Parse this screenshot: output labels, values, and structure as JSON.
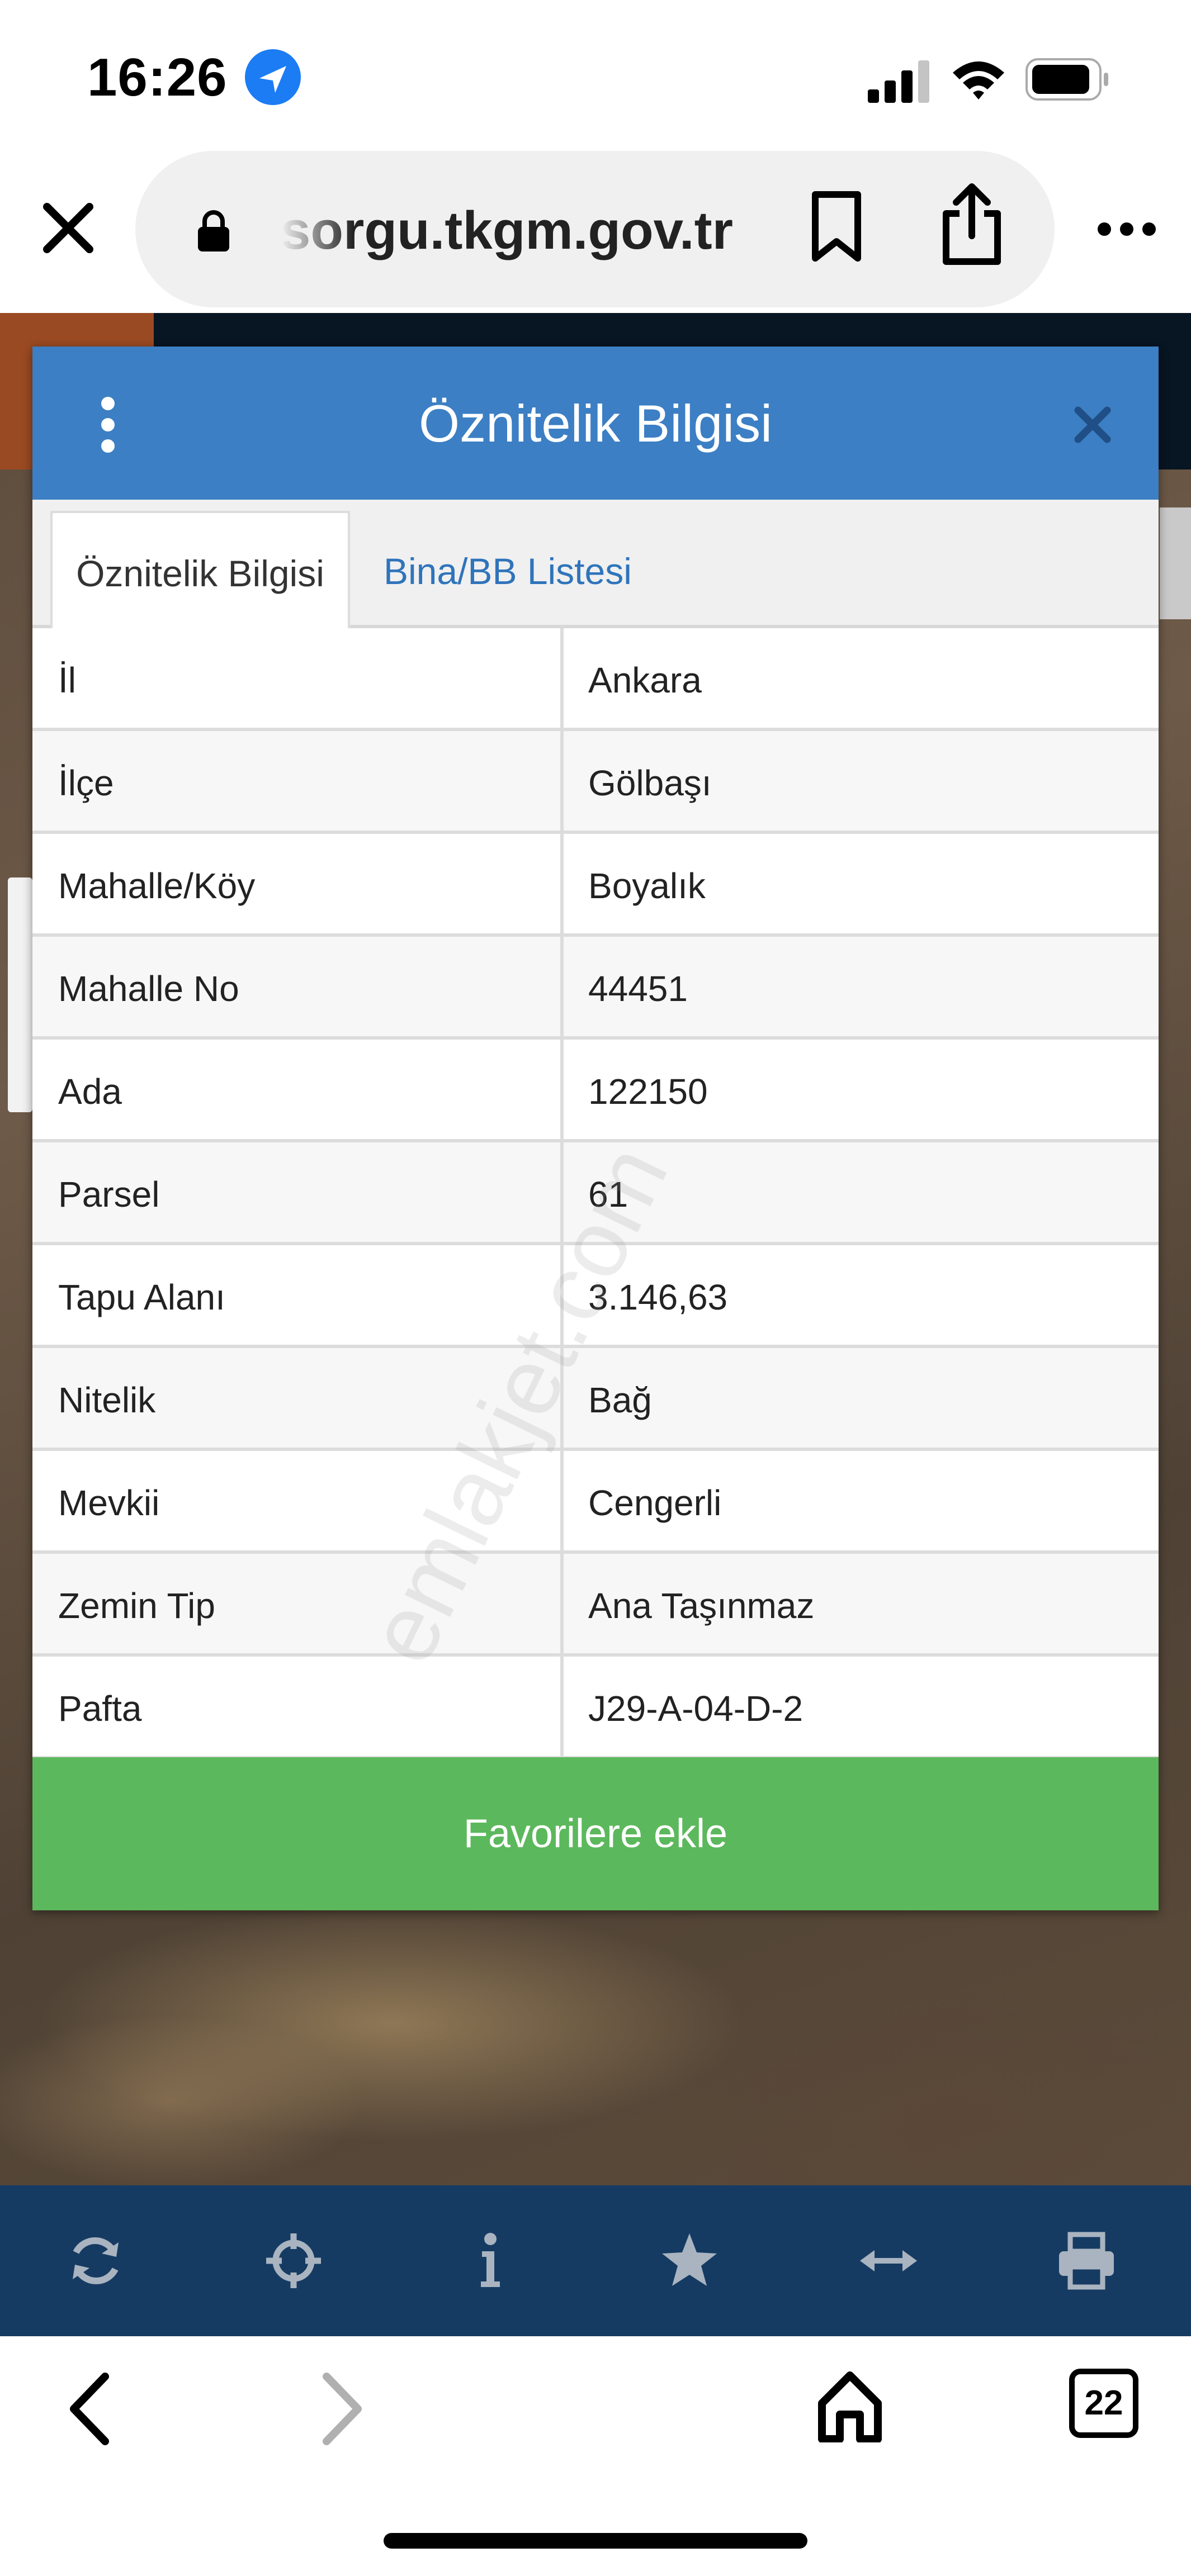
{
  "status_bar": {
    "time": "16:26",
    "icons": [
      "location-arrow-icon",
      "signal-icon",
      "wifi-icon",
      "battery-icon"
    ]
  },
  "browser": {
    "url": "sorgu.tkgm.gov.tr",
    "icons": [
      "close-icon",
      "lock-icon",
      "bookmark-icon",
      "share-icon",
      "more-icon"
    ]
  },
  "modal": {
    "title": "Öznitelik Bilgisi",
    "tabs": [
      {
        "label": "Öznitelik Bilgisi",
        "active": true
      },
      {
        "label": "Bina/BB Listesi",
        "active": false
      }
    ],
    "rows": [
      {
        "key": "İl",
        "value": "Ankara"
      },
      {
        "key": "İlçe",
        "value": "Gölbaşı"
      },
      {
        "key": "Mahalle/Köy",
        "value": "Boyalık"
      },
      {
        "key": "Mahalle No",
        "value": "44451"
      },
      {
        "key": "Ada",
        "value": "122150"
      },
      {
        "key": "Parsel",
        "value": "61"
      },
      {
        "key": "Tapu Alanı",
        "value": "3.146,63"
      },
      {
        "key": "Nitelik",
        "value": "Bağ"
      },
      {
        "key": "Mevkii",
        "value": "Cengerli"
      },
      {
        "key": "Zemin Tip",
        "value": "Ana Taşınmaz"
      },
      {
        "key": "Pafta",
        "value": "J29-A-04-D-2"
      }
    ],
    "favorite_label": "Favorilere ekle",
    "watermark": "emlakjet.com"
  },
  "map_toolbar": {
    "icons": [
      "refresh-icon",
      "crosshair-icon",
      "info-icon",
      "star-icon",
      "measure-icon",
      "print-icon"
    ]
  },
  "safari_bar": {
    "tab_count": "22",
    "icons": [
      "back-icon",
      "forward-icon",
      "home-icon",
      "tabs-icon"
    ]
  },
  "colors": {
    "header_blue": "#3c7fc4",
    "tab_link_blue": "#2f74bb",
    "favorite_green": "#5cb85c",
    "toolbar_navy": "#163b63",
    "toolbar_icon": "#a9b4c0"
  }
}
